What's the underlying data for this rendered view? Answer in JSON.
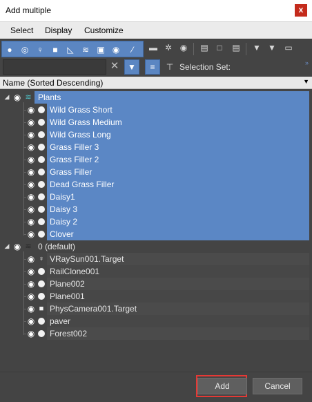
{
  "window": {
    "title": "Add multiple",
    "close_label": "x"
  },
  "menu": [
    "Select",
    "Display",
    "Customize"
  ],
  "toolbar": {
    "type_icons": [
      "geometry-filter-icon",
      "shape-filter-icon",
      "light-filter-icon",
      "camera-filter-icon",
      "helper-filter-icon",
      "spacewarp-filter-icon",
      "group-filter-icon",
      "xref-filter-icon",
      "bone-filter-icon"
    ],
    "display_icons": [
      "container-icon",
      "frozen-icon",
      "hidden-icon",
      "column-icon-1",
      "column-icon-2",
      "column-icon-3",
      "filter-icon",
      "filter-all-icon",
      "layer-toggle-icon"
    ]
  },
  "search": {
    "value": "",
    "placeholder": ""
  },
  "selection_set": {
    "label": "Selection Set:"
  },
  "column_header": {
    "label": "Name (Sorted Descending)"
  },
  "tree": {
    "layers": [
      {
        "name": "Plants",
        "selected": true,
        "children": [
          "Wild Grass Short",
          "Wild Grass Medium",
          "Wild Grass Long",
          "Grass Filler 3",
          "Grass Filler 2",
          "Grass Filler",
          "Dead Grass Filler",
          "Daisy1",
          "Daisy 3",
          "Daisy 2",
          "Clover"
        ]
      },
      {
        "name": "0 (default)",
        "selected": false,
        "children": [
          {
            "name": "VRaySun001.Target",
            "icon": "light"
          },
          {
            "name": "RailClone001",
            "icon": "dot"
          },
          {
            "name": "Plane002",
            "icon": "dot"
          },
          {
            "name": "Plane001",
            "icon": "dot"
          },
          {
            "name": "PhysCamera001.Target",
            "icon": "camera"
          },
          {
            "name": "paver",
            "icon": "dot"
          },
          {
            "name": "Forest002",
            "icon": "dot"
          }
        ]
      }
    ]
  },
  "buttons": {
    "add": "Add",
    "cancel": "Cancel"
  },
  "colors": {
    "selection": "#5b87c5",
    "highlight_frame": "#e53935",
    "accent": "#5b86c2"
  }
}
